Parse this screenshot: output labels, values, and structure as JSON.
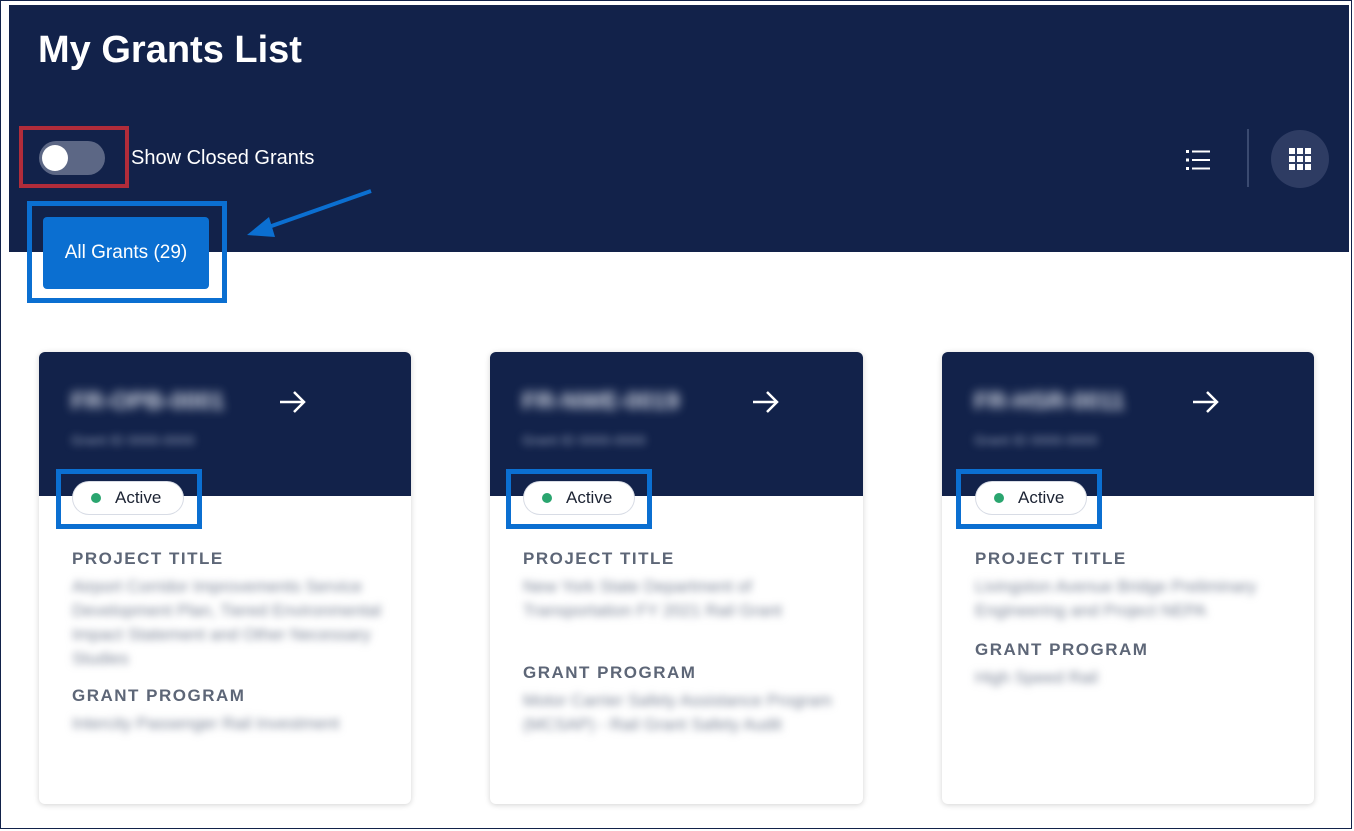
{
  "page": {
    "title": "My Grants List"
  },
  "filters": {
    "show_closed_label": "Show Closed Grants",
    "show_closed_on": false
  },
  "tabs": {
    "all_grants_label": "All Grants (29)"
  },
  "view_toggle": {
    "list_icon": "list-icon",
    "grid_icon": "grid-icon",
    "selected": "grid"
  },
  "colors": {
    "header": "#12224a",
    "accent": "#0b6fd1",
    "status_active": "#2aa56f",
    "annotation_red": "#b12c3a",
    "annotation_blue": "#0b6fd1"
  },
  "cards": [
    {
      "id": "FR-OPB-0001",
      "subtitle": "Grant ID 0000-0000",
      "status": "Active",
      "project_title_label": "PROJECT TITLE",
      "project_title": "Airport Corridor Improvements Service Development Plan, Tiered Environmental Impact Statement and Other Necessary Studies",
      "grant_program_label": "GRANT PROGRAM",
      "grant_program": "Intercity Passenger Rail Investment"
    },
    {
      "id": "FR-NWE-0019",
      "subtitle": "Grant ID 0000-0000",
      "status": "Active",
      "project_title_label": "PROJECT TITLE",
      "project_title": "New York State Department of Transportation FY 2021 Rail Grant",
      "grant_program_label": "GRANT PROGRAM",
      "grant_program": "Motor Carrier Safety Assistance Program (MCSAP) - Rail Grant Safety Audit"
    },
    {
      "id": "FR-HSR-0011",
      "subtitle": "Grant ID 0000-0000",
      "status": "Active",
      "project_title_label": "PROJECT TITLE",
      "project_title": "Livingston Avenue Bridge Preliminary Engineering and Project NEPA",
      "grant_program_label": "GRANT PROGRAM",
      "grant_program": "High Speed Rail"
    }
  ]
}
